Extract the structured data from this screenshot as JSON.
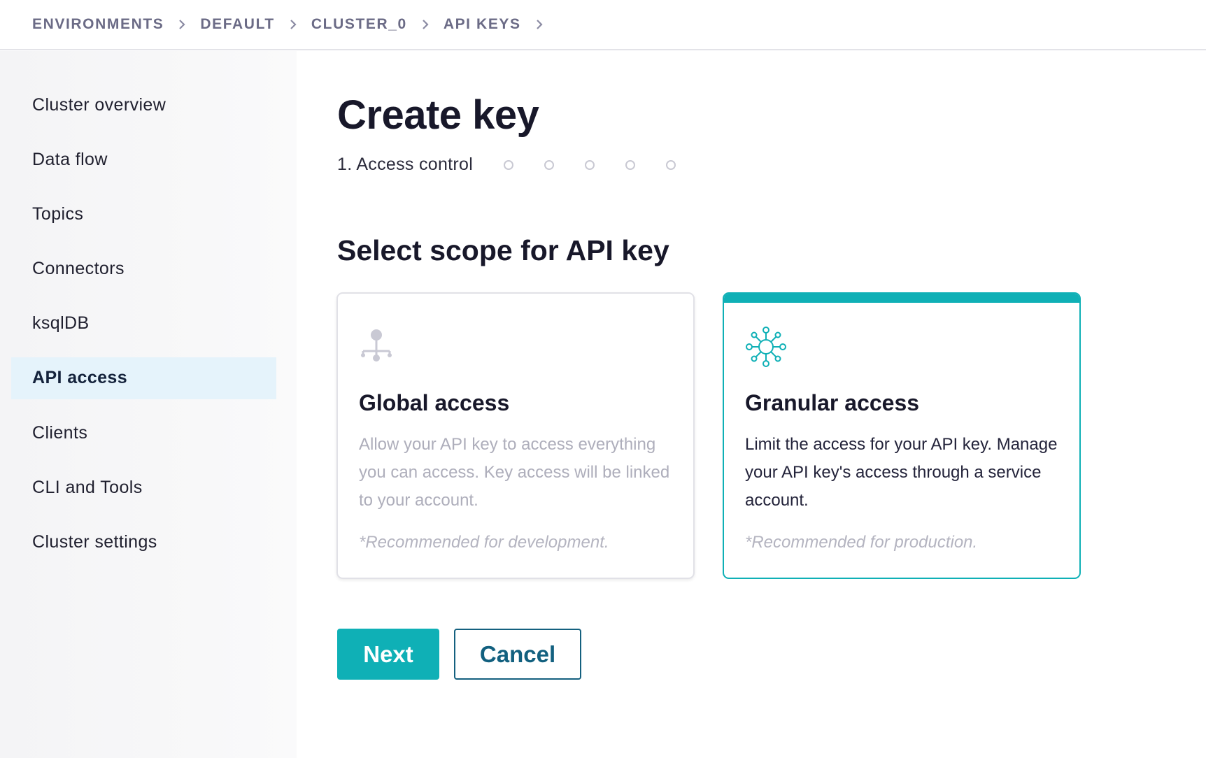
{
  "breadcrumb": {
    "items": [
      {
        "label": "ENVIRONMENTS"
      },
      {
        "label": "DEFAULT"
      },
      {
        "label": "CLUSTER_0"
      },
      {
        "label": "API KEYS"
      }
    ]
  },
  "sidebar": {
    "items": [
      {
        "label": "Cluster overview"
      },
      {
        "label": "Data flow"
      },
      {
        "label": "Topics"
      },
      {
        "label": "Connectors"
      },
      {
        "label": "ksqlDB"
      },
      {
        "label": "API access",
        "active": true
      },
      {
        "label": "Clients"
      },
      {
        "label": "CLI and Tools"
      },
      {
        "label": "Cluster settings"
      }
    ]
  },
  "main": {
    "title": "Create key",
    "stepper": {
      "current_label": "1. Access control",
      "current_step": 1,
      "total_steps": 6
    },
    "section_title": "Select scope for API key",
    "cards": {
      "global": {
        "icon": "hierarchy-icon",
        "title": "Global access",
        "description": "Allow your API key to access everything you can access. Key access will be linked to your account.",
        "note": "*Recommended for development.",
        "selected": false
      },
      "granular": {
        "icon": "network-nodes-icon",
        "title": "Granular access",
        "description": "Limit the access for your API key. Manage your API key's access through a service account.",
        "note": "*Recommended for production.",
        "selected": true
      }
    },
    "buttons": {
      "next_label": "Next",
      "cancel_label": "Cancel"
    }
  },
  "colors": {
    "accent": "#0fb0b6",
    "active_nav_bg": "#e5f3fb",
    "cancel_text": "#12607f",
    "breadcrumb_text": "#6b6b86"
  }
}
